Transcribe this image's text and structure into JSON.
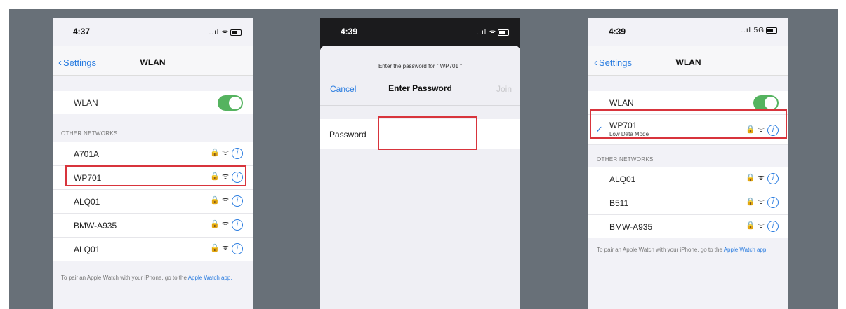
{
  "phone1": {
    "time": "4:37",
    "status_icons": "..ıl ᯤ",
    "back_label": "Settings",
    "title": "WLAN",
    "wlan_label": "WLAN",
    "section_header": "OTHER NETWORKS",
    "networks": [
      "A701A",
      "WP701",
      "ALQ01",
      "BMW-A935",
      "ALQ01"
    ],
    "footer_text": "To pair an Apple Watch with your iPhone, go to the ",
    "footer_link": "Apple Watch app."
  },
  "phone2": {
    "time": "4:39",
    "status_icons": "..ıl ᯤ",
    "prompt": "Enter the password for \" WP701 \"",
    "cancel_label": "Cancel",
    "title": "Enter Password",
    "join_label": "Join",
    "password_label": "Password",
    "password_value": ""
  },
  "phone3": {
    "time": "4:39",
    "status_icons": "..ıl 5G",
    "back_label": "Settings",
    "title": "WLAN",
    "wlan_label": "WLAN",
    "connected_network": "WP701",
    "connected_sub": "Low Data Mode",
    "section_header": "OTHER NETWORKS",
    "networks": [
      "ALQ01",
      "B511",
      "BMW-A935"
    ],
    "footer_text": "To pair an Apple Watch with your iPhone, go to the ",
    "footer_link": "Apple Watch app."
  },
  "icons": {
    "lock": "🔒",
    "wifi": "ᯤ",
    "info": "i",
    "check": "✓",
    "back_chevron": "‹"
  },
  "colors": {
    "accent": "#2b7de0",
    "toggle_on": "#55b35f",
    "highlight": "#d8343c",
    "frame_bg": "#687078"
  }
}
